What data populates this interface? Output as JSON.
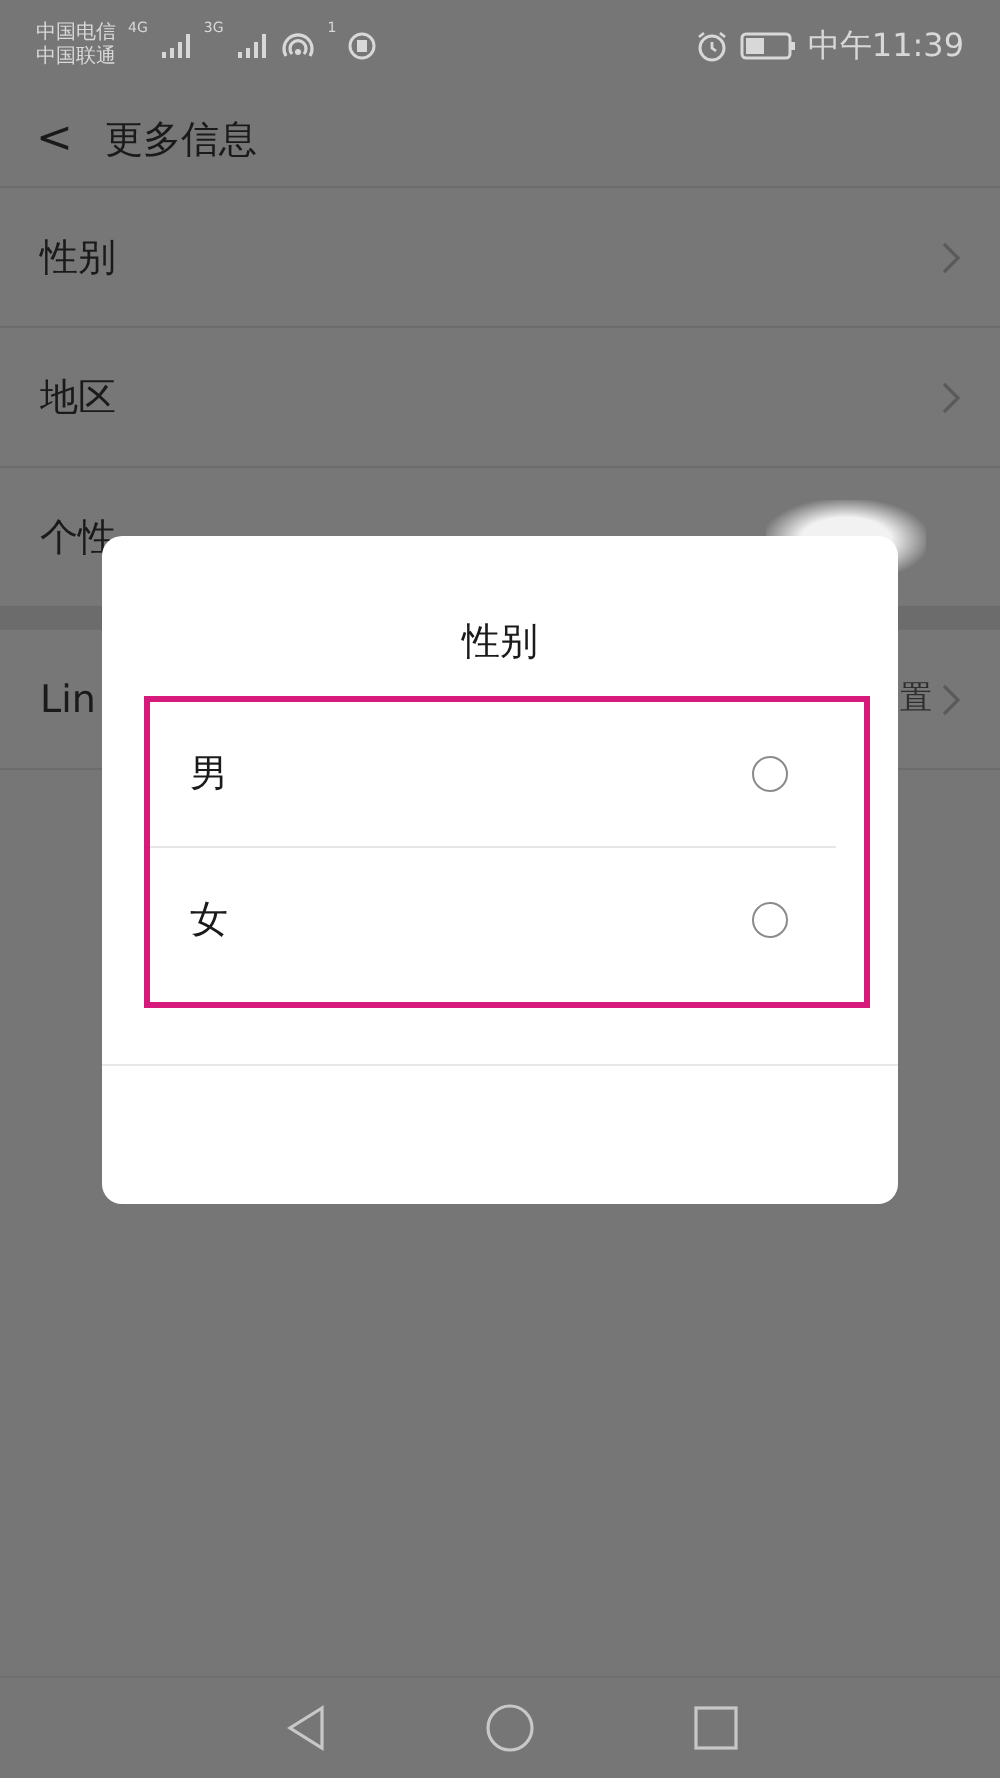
{
  "status_bar": {
    "carriers": [
      "中国电信",
      "中国联通"
    ],
    "network_1": "4G",
    "network_2": "3G",
    "hotspot_count": "1",
    "time": "中午11:39"
  },
  "header": {
    "back": "<",
    "title": "更多信息"
  },
  "rows": [
    {
      "label": "性别",
      "kind": "link"
    },
    {
      "label": "地区",
      "kind": "link"
    },
    {
      "label": "个性",
      "kind": "redacted"
    }
  ],
  "section_2_rows": [
    {
      "label": "Lin",
      "value": "置",
      "kind": "link"
    }
  ],
  "dialog": {
    "title": "性别",
    "options": [
      {
        "label": "男",
        "selected": false
      },
      {
        "label": "女",
        "selected": false
      }
    ],
    "highlighted": true
  }
}
